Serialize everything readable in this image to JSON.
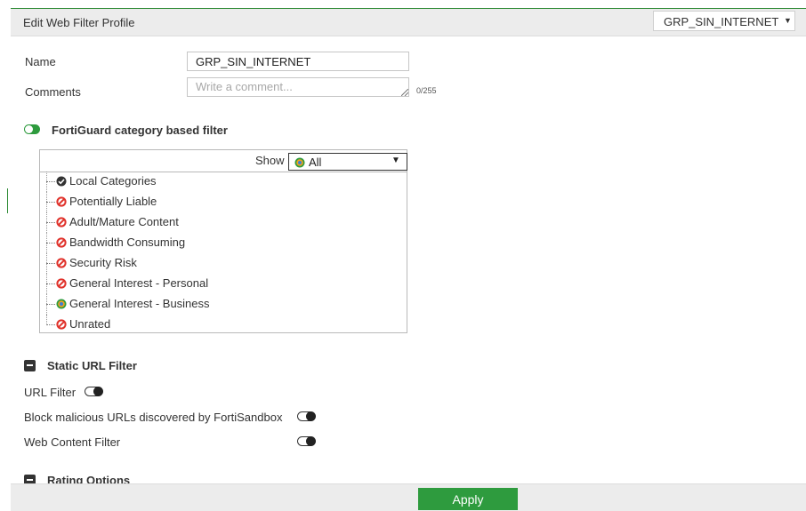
{
  "header": {
    "title": "Edit Web Filter Profile",
    "profile_select_value": "GRP_SIN_INTERNET"
  },
  "form": {
    "name_label": "Name",
    "name_value": "GRP_SIN_INTERNET",
    "comments_label": "Comments",
    "comments_placeholder": "Write a comment...",
    "comments_counter": "0/255"
  },
  "fortiguard": {
    "title": "FortiGuard category based filter",
    "enabled": true,
    "show_label": "Show",
    "show_value": "All",
    "categories": [
      {
        "label": "Local Categories",
        "icon": "check-circle-icon"
      },
      {
        "label": "Potentially Liable",
        "icon": "block-icon"
      },
      {
        "label": "Adult/Mature Content",
        "icon": "block-icon"
      },
      {
        "label": "Bandwidth Consuming",
        "icon": "block-icon"
      },
      {
        "label": "Security Risk",
        "icon": "block-icon"
      },
      {
        "label": "General Interest - Personal",
        "icon": "block-icon"
      },
      {
        "label": "General Interest - Business",
        "icon": "mixed-action-icon"
      },
      {
        "label": "Unrated",
        "icon": "block-icon"
      }
    ]
  },
  "static_url": {
    "title": "Static URL Filter",
    "url_filter_label": "URL Filter",
    "block_malicious_label": "Block malicious URLs discovered by FortiSandbox",
    "web_content_label": "Web Content Filter"
  },
  "rating": {
    "title": "Rating Options"
  },
  "footer": {
    "apply_label": "Apply"
  },
  "colors": {
    "accent_green": "#2e9b3e",
    "block_red": "#e0322b"
  }
}
